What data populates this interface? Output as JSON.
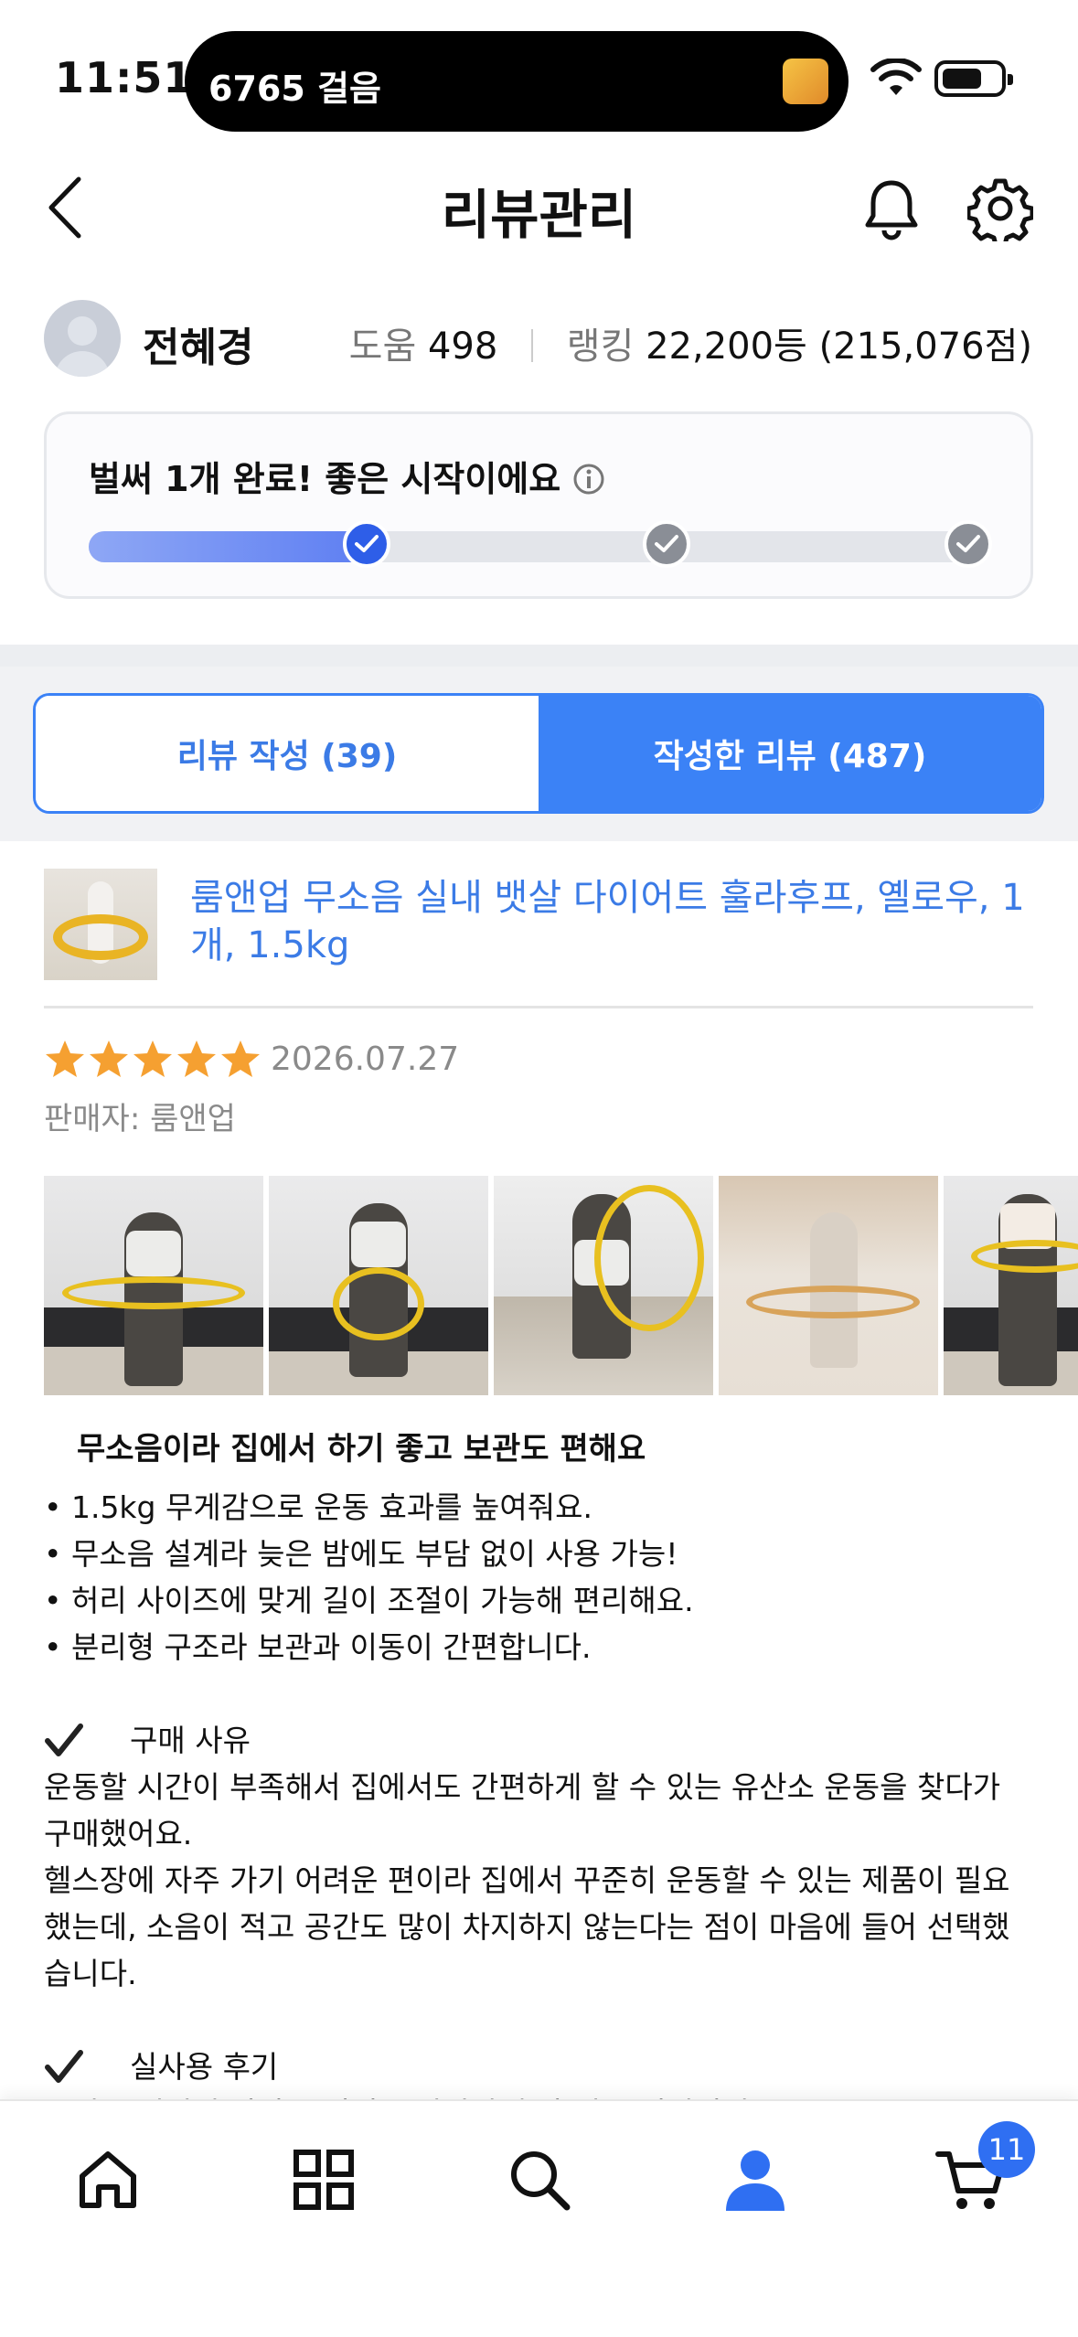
{
  "status_bar": {
    "time": "11:51",
    "live_activity": "6765 걸음"
  },
  "header": {
    "title": "리뷰관리"
  },
  "profile": {
    "name": "전혜경",
    "help_label": "도움",
    "help_count": "498",
    "ranking_label": "랭킹",
    "ranking_value": "22,200등 (215,076점)"
  },
  "progress": {
    "message": "벌써 1개 완료! 좋은 시작이에요",
    "completed_fraction": 0.33,
    "steps_total": 3,
    "steps_done": 1
  },
  "tabs": [
    {
      "label": "리뷰 작성 (39)",
      "active": false
    },
    {
      "label": "작성한 리뷰 (487)",
      "active": true
    }
  ],
  "review": {
    "product_title": "룸앤업 무소음 실내 뱃살 다이어트 훌라후프, 옐로우, 1개, 1.5kg",
    "rating": 5,
    "date": "2026.07.27",
    "seller": "판매자: 룸앤업",
    "headline": "무소음이라 집에서 하기 좋고 보관도 편해요",
    "bullets": [
      "• 1.5kg 무게감으로 운동 효과를 높여줘요.",
      "• 무소음 설계라 늦은 밤에도 부담 없이 사용 가능!",
      "• 허리 사이즈에 맞게 길이 조절이 가능해 편리해요.",
      "• 분리형 구조라 보관과 이동이 간편합니다."
    ],
    "section1_title": "구매 사유",
    "section1_lines": [
      "운동할 시간이 부족해서 집에서도 간편하게 할 수 있는 유산소 운동을 찾다가",
      "구매했어요.",
      "헬스장에 자주 가기 어려운 편이라 집에서 꾸준히 운동할 수 있는 제품이 필요",
      "했는데, 소음이 적고 공간도 많이 차지하지 않는다는 점이 마음에 들어 선택했",
      "습니다."
    ],
    "section2_title": "실사용 후기",
    "section2_partial": "조립은 어렵지 않았고 연결도 단단하게 잘 되는 편이었어요."
  },
  "bottom_nav": {
    "items": [
      "home-icon",
      "grid-icon",
      "search-icon",
      "person-icon",
      "cart-icon"
    ],
    "active": "person-icon",
    "cart_count": "11"
  },
  "colors": {
    "accent": "#3b82f6",
    "link": "#3b7be6",
    "star": "#f5a031"
  }
}
